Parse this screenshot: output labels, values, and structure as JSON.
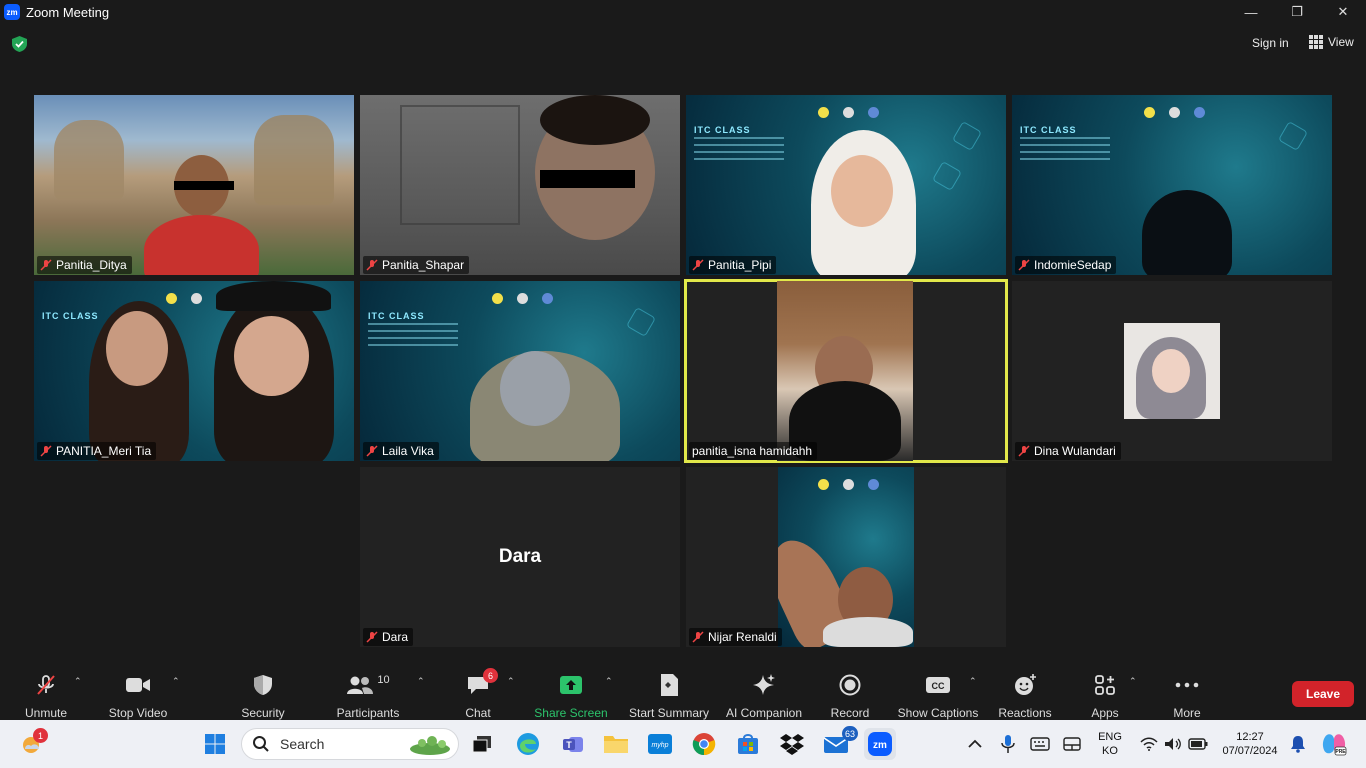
{
  "window": {
    "title": "Zoom Meeting",
    "app_icon": "zm"
  },
  "topbar": {
    "sign_in": "Sign in",
    "view_label": "View"
  },
  "participants": [
    {
      "name": "Panitia_Ditya",
      "muted": true
    },
    {
      "name": "Panitia_Shapar",
      "muted": true
    },
    {
      "name": "Panitia_Pipi",
      "muted": true
    },
    {
      "name": "IndomieSedap",
      "muted": true
    },
    {
      "name": "PANITIA_Meri Tia",
      "muted": true
    },
    {
      "name": "Laila Vika",
      "muted": true
    },
    {
      "name": "panitia_isna hamidahh",
      "muted": false,
      "active_speaker": true
    },
    {
      "name": "Dina Wulandari",
      "muted": true
    },
    {
      "name": "Dara",
      "muted": true,
      "video_off": true
    },
    {
      "name": "Nijar Renaldi",
      "muted": true
    }
  ],
  "virtual_background": {
    "title": "ITC CLASS"
  },
  "toolbar": {
    "unmute": "Unmute",
    "stop_video": "Stop Video",
    "security": "Security",
    "participants": "Participants",
    "participants_count": "10",
    "chat": "Chat",
    "chat_badge": "6",
    "share_screen": "Share Screen",
    "start_summary": "Start Summary",
    "ai_companion": "AI Companion",
    "record": "Record",
    "show_captions": "Show Captions",
    "reactions": "Reactions",
    "apps": "Apps",
    "more": "More",
    "leave": "Leave"
  },
  "taskbar": {
    "search_placeholder": "Search",
    "weather_badge": "1",
    "mail_badge": "63",
    "lang_top": "ENG",
    "lang_bottom": "KO",
    "time": "12:27",
    "date": "07/07/2024"
  },
  "colors": {
    "active_border": "#e2e84a",
    "share_green": "#2cc36b",
    "leave_red": "#d2232a",
    "badge_red": "#e0323c"
  }
}
